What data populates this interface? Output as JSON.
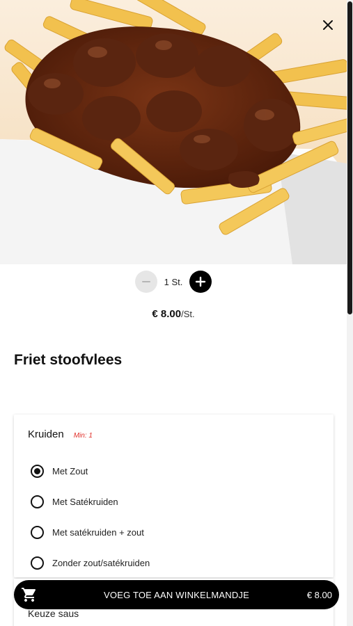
{
  "dialog": {
    "close_icon": "close-icon"
  },
  "product": {
    "image_alt": "Friet stoofvlees",
    "title": "Friet stoofvlees",
    "price": "€ 8.00",
    "price_unit": "/St."
  },
  "quantity": {
    "value": "1 St.",
    "minus_icon": "minus-icon",
    "plus_icon": "plus-icon"
  },
  "option_groups": [
    {
      "title": "Kruiden",
      "min_label": "Min: 1",
      "options": [
        {
          "label": "Met Zout",
          "selected": true
        },
        {
          "label": "Met Satékruiden",
          "selected": false
        },
        {
          "label": "Met satékruiden + zout",
          "selected": false
        },
        {
          "label": "Zonder zout/satékruiden",
          "selected": false
        }
      ]
    },
    {
      "title": "Keuze saus"
    }
  ],
  "cart_bar": {
    "icon": "cart-icon",
    "label": "VOEG TOE AAN WINKELMANDJE",
    "total": "€ 8.00"
  },
  "colors": {
    "accent": "#000000",
    "min_label": "#e0302a",
    "minus_button_bg": "#e6e6e6"
  }
}
